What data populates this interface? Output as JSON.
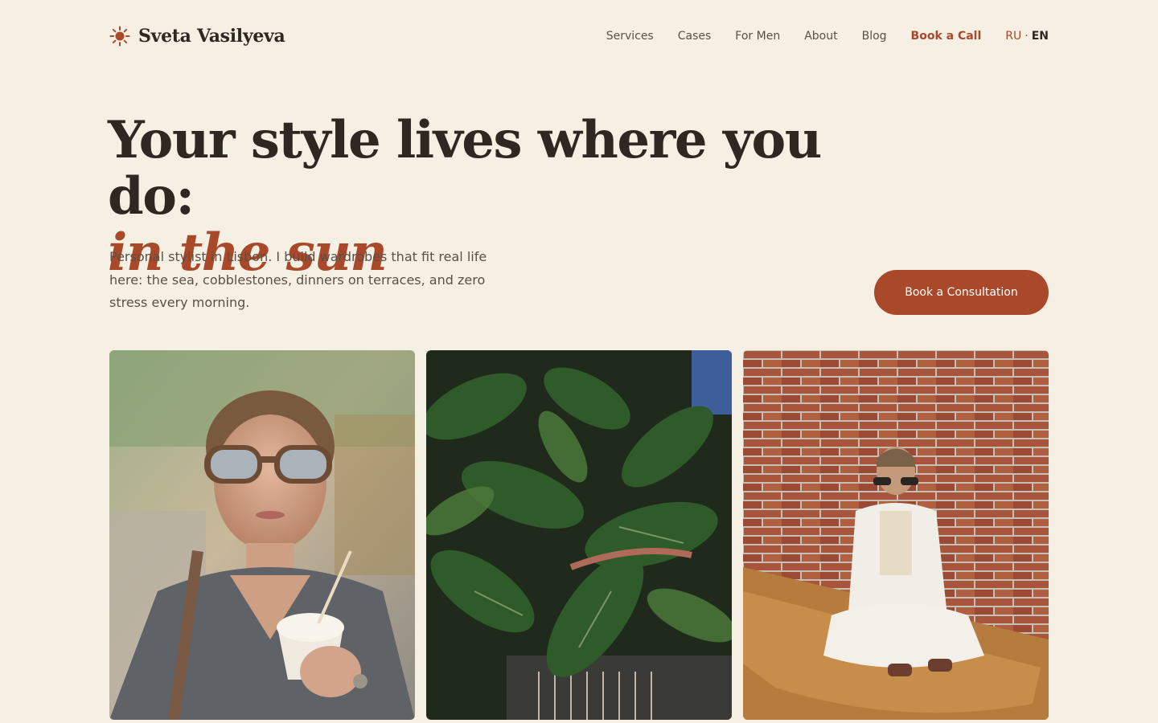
{
  "brand": {
    "name": "Sveta Vasilyeva",
    "icon": "sun-icon",
    "accent_color": "#a9492a"
  },
  "nav": {
    "items": [
      "Services",
      "Cases",
      "For Men",
      "About",
      "Blog"
    ],
    "book_call": "Book a Call",
    "lang_ru": "RU",
    "lang_sep": "·",
    "lang_en": "EN"
  },
  "hero": {
    "title_line1": "Your style lives where you do:",
    "title_line2": "in the sun",
    "intro": "Personal stylist in Lisbon. I build wardrobes that fit real life here: the sea, cobblestones, dinners on terraces, and zero stress every morning.",
    "cta": "Book a Consultation"
  },
  "gallery": {
    "photos": [
      {
        "alt": "portrait with sunglasses and ice cream"
      },
      {
        "alt": "green ficus leaves"
      },
      {
        "alt": "woman in white suit sitting by brick wall"
      }
    ]
  }
}
